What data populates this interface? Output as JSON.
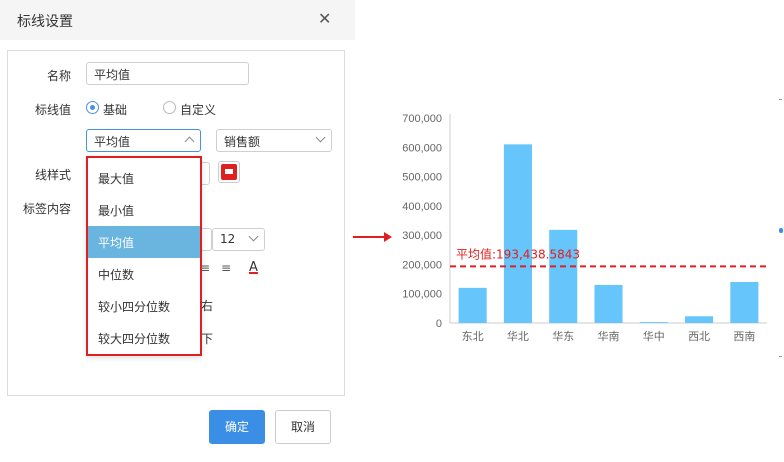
{
  "dialog": {
    "title": "标线设置",
    "close_icon": "close-icon",
    "name_label": "名称",
    "name_value": "平均值",
    "value_label": "标线值",
    "radio_basic": "基础",
    "radio_custom": "自定义",
    "agg_select_value": "平均值",
    "field_select_value": "销售额",
    "style_label": "线样式",
    "label_content_label": "标签内容",
    "font_size_value": "12",
    "align_right_peek": "右",
    "align_bottom_peek": "下",
    "font_color_glyph": "A",
    "ok_label": "确定",
    "cancel_label": "取消"
  },
  "dropdown": {
    "options": [
      "最大值",
      "最小值",
      "平均值",
      "中位数",
      "较小四分位数",
      "较大四分位数"
    ],
    "selected": "平均值"
  },
  "chart_data": {
    "type": "bar",
    "categories": [
      "东北",
      "华北",
      "华东",
      "华南",
      "华中",
      "西北",
      "西南"
    ],
    "values": [
      120000,
      610000,
      318000,
      130000,
      3000,
      23000,
      140000
    ],
    "yticks": [
      "0",
      "100,000",
      "200,000",
      "300,000",
      "400,000",
      "500,000",
      "600,000",
      "700,000"
    ],
    "ylim": [
      0,
      700000
    ],
    "bar_color": "#66c5fa",
    "mark_line": {
      "label": "平均值:193,438.5843",
      "value": 193438.5843,
      "color": "#e02020"
    },
    "grid": false
  },
  "colors": {
    "accent": "#3a8ee6",
    "highlight_border": "#e02020",
    "selected_item": "#6ab4e0"
  }
}
